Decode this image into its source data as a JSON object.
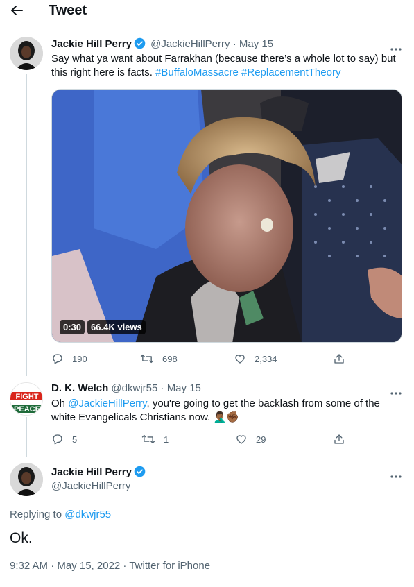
{
  "header": {
    "title": "Tweet"
  },
  "tweet1": {
    "name": "Jackie Hill Perry",
    "handle": "@JackieHillPerry",
    "sep": "·",
    "date": "May 15",
    "text_plain": "Say what ya want about Farrakhan (because there’s a whole lot to say) but this right here is facts. ",
    "hashtag1": "#BuffaloMassacre",
    "hashtag2": "#ReplacementTheory",
    "media": {
      "duration": "0:30",
      "views": "66.4K views"
    },
    "replies": "190",
    "retweets": "698",
    "likes": "2,334"
  },
  "tweet2": {
    "name": "D. K. Welch",
    "handle": "@dkwjr55",
    "sep": "·",
    "date": "May 15",
    "text_pre": "Oh ",
    "mention": "@JackieHillPerry",
    "text_post": ", you're going to get the backlash from some of the white Evangelicals Christians  now. ",
    "emoji": "🤦🏾‍♂️✊🏾",
    "avatar_text_top": "FIGHT",
    "avatar_text_bottom": "PEACE",
    "replies": "5",
    "retweets": "1",
    "likes": "29"
  },
  "tweet3": {
    "name": "Jackie Hill Perry",
    "handle": "@JackieHillPerry",
    "replying_label": "Replying to ",
    "replying_handle": "@dkwjr55",
    "text": "Ok.",
    "meta": "9:32 AM · May 15, 2022 · Twitter for iPhone"
  },
  "colors": {
    "accent": "#1d9bf0",
    "muted": "#536471",
    "text": "#0f1419",
    "line": "#cfd9de"
  }
}
